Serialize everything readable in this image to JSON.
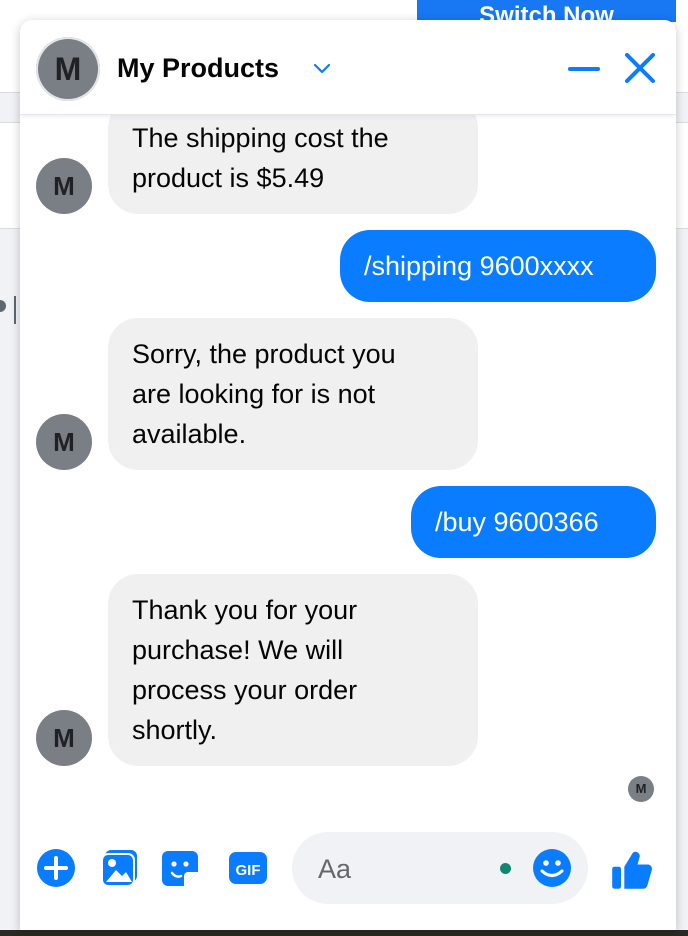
{
  "background": {
    "switch_button_label": "Switch Now"
  },
  "chat": {
    "title": "My Products",
    "avatar_initial": "M",
    "messages": [
      {
        "direction": "incoming",
        "lines": [
          "The shipping cost the",
          "product is $5.49"
        ]
      },
      {
        "direction": "outgoing",
        "lines": [
          "/shipping 9600xxxx"
        ]
      },
      {
        "direction": "incoming",
        "lines": [
          "Sorry, the product you",
          "are looking for is not",
          "available."
        ]
      },
      {
        "direction": "outgoing",
        "lines": [
          "/buy 9600366"
        ]
      },
      {
        "direction": "incoming",
        "lines": [
          "Thank you for your",
          "purchase! We will",
          "process your order",
          "shortly."
        ]
      }
    ],
    "seen_avatar_initial": "M"
  },
  "composer": {
    "placeholder": "Aa",
    "icons": [
      "plus-icon",
      "photo-icon",
      "sticker-icon",
      "gif-icon",
      "emoji-icon",
      "thumbs-up-icon"
    ],
    "gif_label": "GIF"
  },
  "colors": {
    "accent": "#0a7cff",
    "incoming_bubble": "#f0f0f0",
    "avatar": "#7a7e85",
    "online": "#12866f"
  }
}
